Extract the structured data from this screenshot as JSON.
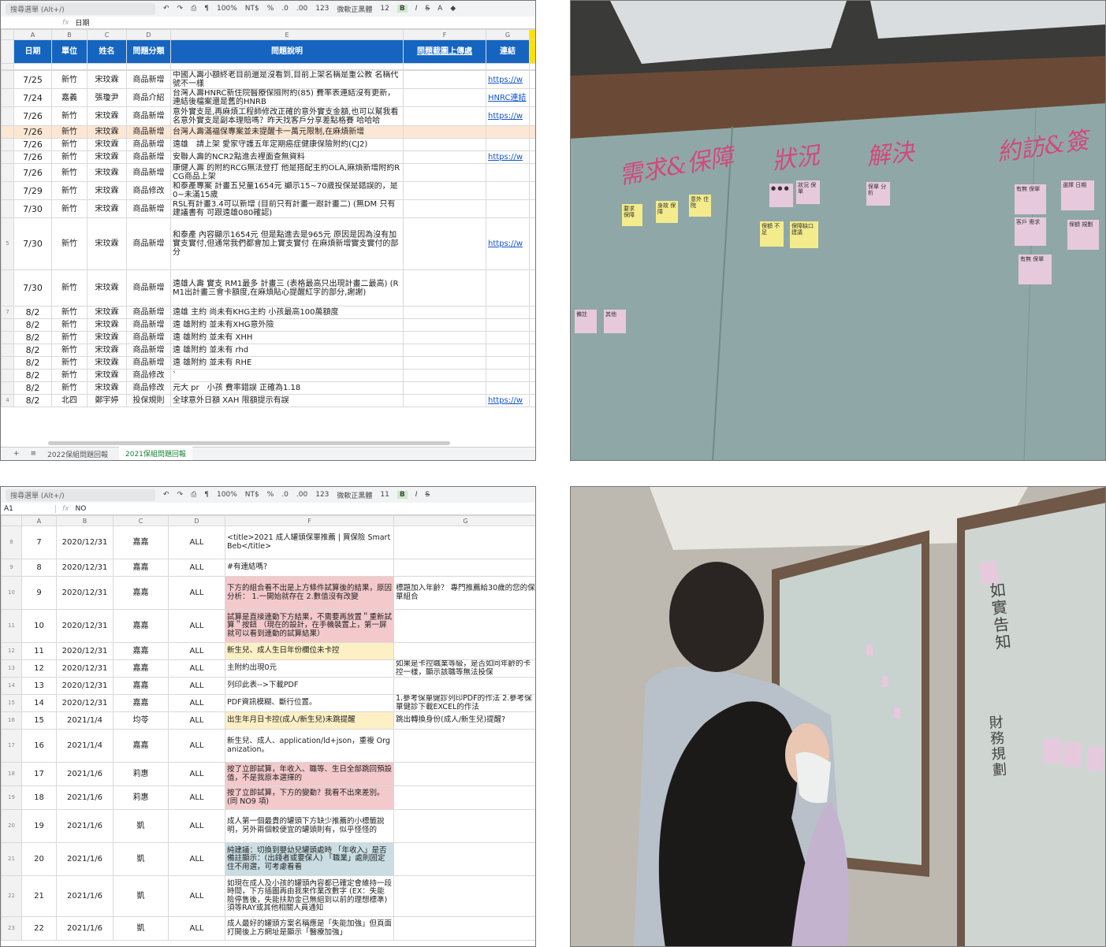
{
  "sheet1": {
    "toolbar": {
      "menu_search": "搜尋選單 (Alt+/)",
      "zoom": "100%",
      "currency": "NT$",
      "percent": "%",
      "dec0": ".0",
      "dec00": ".00",
      "format": "123",
      "font": "微軟正黑體",
      "size": "12",
      "bold": "B",
      "italic": "I",
      "strike": "S",
      "textcolor": "A"
    },
    "formula": {
      "ref": "",
      "fx": "fx",
      "value": "日期"
    },
    "columns": [
      "A",
      "B",
      "C",
      "D",
      "E",
      "F",
      "G"
    ],
    "headers": [
      "日期",
      "單位",
      "姓名",
      "問題分類",
      "問題說明",
      "問題截圖上傳處",
      "連結"
    ],
    "rows": [
      {
        "rn": "",
        "date": "7/25",
        "unit": "新竹",
        "name": "宋玟霖",
        "cat": "商品新增",
        "desc": "中國人壽小額終老目前還是沒看到,目前上架名稱是重公教 名稱代號不一樣",
        "link": "https://w"
      },
      {
        "rn": "",
        "date": "7/24",
        "unit": "嘉義",
        "name": "張瓊尹",
        "cat": "商品介紹",
        "desc": "台灣人壽HNRC新住院醫療保險附約(85) 費率表連結沒有更新，連結後檔案還是舊的HNRB",
        "link": "HNRC連結"
      },
      {
        "rn": "",
        "date": "7/26",
        "unit": "新竹",
        "name": "宋玟霖",
        "cat": "商品新增",
        "desc": "意外實支是,再麻煩工程師修改正確的意外實支金額,也可以幫我看名意外實支是副本理賠嗎？昨天找客戶分享差點格賽 哈哈哈",
        "link": "https://w"
      },
      {
        "rn": "",
        "date": "7/26",
        "unit": "新竹",
        "name": "宋玟霖",
        "cat": "商品新增",
        "desc": "台灣人壽滿福保專案並未提醒卡一萬元限制,在麻煩新增",
        "link": "",
        "hl": true
      },
      {
        "rn": "",
        "date": "7/26",
        "unit": "新竹",
        "name": "宋玟霖",
        "cat": "商品新增",
        "desc": "遠雄　請上架 愛家守護五年定期癌症健康保險附約(CJ2)",
        "link": ""
      },
      {
        "rn": "",
        "date": "7/26",
        "unit": "新竹",
        "name": "宋玟霖",
        "cat": "商品新增",
        "desc": "安聯人壽的NCR2點進去裡面查無資料",
        "link": "https://w"
      },
      {
        "rn": "",
        "date": "7/26",
        "unit": "新竹",
        "name": "宋玟霖",
        "cat": "商品新增",
        "desc": "康健人壽 的附約RCG無法登打 他是搭配主約OLA,麻煩新增附約RCG商品上架",
        "link": ""
      },
      {
        "rn": "",
        "date": "7/29",
        "unit": "新竹",
        "name": "宋玟霖",
        "cat": "商品修改",
        "desc": "和泰產專案 計畫五兒童1654元 顯示15~70歲投保是錯誤的，是0~未滿15歲",
        "link": ""
      },
      {
        "rn": "",
        "date": "7/30",
        "unit": "新竹",
        "name": "宋玟霖",
        "cat": "商品新增",
        "desc": "RSL有計畫3.4可以新增 (目前只有計畫一跟計畫二) (無DM 只有建議書有 可跟遠雄080確認)",
        "link": ""
      },
      {
        "rn": "5",
        "date": "7/30",
        "unit": "新竹",
        "name": "宋玟霖",
        "cat": "商品新增",
        "desc": "和泰產 內容顯示1654元 但是點進去是965元 原因是因為沒有加實支實付,但通常我們都會加上實支實付 在麻煩新增實支實付的部分",
        "link": "https://w",
        "tall": true
      },
      {
        "rn": "",
        "date": "7/30",
        "unit": "新竹",
        "name": "宋玟霖",
        "cat": "商品新增",
        "desc": "遠雄人壽 實支 RM1最多 計畫三 (表格最高只出現計畫二最高) (RM1出計畫三會卡額度,在麻煩貼心提醒紅字的部分,謝謝)",
        "link": "",
        "tall2": true
      },
      {
        "rn": "7",
        "date": "8/2",
        "unit": "新竹",
        "name": "宋玟霖",
        "cat": "商品新增",
        "desc": "遠雄 主約 尚未有KHG主約 小孩最高100萬額度",
        "link": ""
      },
      {
        "rn": "",
        "date": "8/2",
        "unit": "新竹",
        "name": "宋玟霖",
        "cat": "商品新增",
        "desc": "遠 雄附約 並未有XHG意外險",
        "link": ""
      },
      {
        "rn": "",
        "date": "8/2",
        "unit": "新竹",
        "name": "宋玟霖",
        "cat": "商品新增",
        "desc": "遠 雄附約 並未有 XHH",
        "link": ""
      },
      {
        "rn": "",
        "date": "8/2",
        "unit": "新竹",
        "name": "宋玟霖",
        "cat": "商品新增",
        "desc": "遠 雄附約 並未有 rhd",
        "link": ""
      },
      {
        "rn": "",
        "date": "8/2",
        "unit": "新竹",
        "name": "宋玟霖",
        "cat": "商品新增",
        "desc": "遠 雄附約 並未有 RHE",
        "link": ""
      },
      {
        "rn": "",
        "date": "8/2",
        "unit": "新竹",
        "name": "宋玟霖",
        "cat": "商品修改",
        "desc": "`",
        "link": ""
      },
      {
        "rn": "",
        "date": "8/2",
        "unit": "新竹",
        "name": "宋玟霖",
        "cat": "商品修改",
        "desc": "元大 pr　小孩 費率錯誤 正確為1.18",
        "link": ""
      },
      {
        "rn": "4",
        "date": "8/2",
        "unit": "北四",
        "name": "鄭宇婷",
        "cat": "投保規則",
        "desc": "全球意外日額 XAH 限額提示有誤",
        "link": "https://w"
      }
    ],
    "tabs": {
      "add": "+",
      "list": "≡",
      "tab1": "2022保組問題回報",
      "tab2": "2021保組問題回報"
    }
  },
  "sheet2": {
    "toolbar": {
      "menu_search": "搜尋選單 (Alt+/)",
      "zoom": "100%",
      "currency": "NT$",
      "percent": "%",
      "dec0": ".0",
      "dec00": ".00",
      "format": "123",
      "font": "微軟正黑體",
      "size": "11",
      "bold": "B",
      "italic": "I",
      "strike": "S"
    },
    "formula": {
      "ref": "A1",
      "fx": "fx",
      "value": "NO"
    },
    "columns": [
      "A",
      "B",
      "C",
      "D",
      "F",
      "G"
    ],
    "rows": [
      {
        "rn": "8",
        "no": "7",
        "date": "2020/12/31",
        "who": "嘉嘉",
        "scope": "ALL",
        "issue": "<title>2021 成人罐頭保單推薦 | 買保險 SmartBeb</title>",
        "note": "",
        "color": ""
      },
      {
        "rn": "9",
        "no": "8",
        "date": "2020/12/31",
        "who": "嘉嘉",
        "scope": "ALL",
        "issue": "#有連結嗎?",
        "note": "",
        "color": ""
      },
      {
        "rn": "10",
        "no": "9",
        "date": "2020/12/31",
        "who": "嘉嘉",
        "scope": "ALL",
        "issue": "下方的組合看不出是上方條件試算後的結果，原因分析： 1.一開始就存在 2.數值沒有改變",
        "note": "標題加入年齡？ 專門推薦給30歲的您的保單組合",
        "color": "pink"
      },
      {
        "rn": "11",
        "no": "10",
        "date": "2020/12/31",
        "who": "嘉嘉",
        "scope": "ALL",
        "issue": "試算是直接連動下方結果，不需要再放置＂重新試算＂按鈕 （現在的設計，在手機裝置上，第一屏就可以看到連動的試算結果）",
        "note": "",
        "color": "pink"
      },
      {
        "rn": "12",
        "no": "11",
        "date": "2020/12/31",
        "who": "嘉嘉",
        "scope": "ALL",
        "issue": "新生兒、成人生日年份欄位未卡控",
        "note": "",
        "color": "yel"
      },
      {
        "rn": "13",
        "no": "12",
        "date": "2020/12/31",
        "who": "嘉嘉",
        "scope": "ALL",
        "issue": "主附約出現0元",
        "note": "如果是卡控職業等級，是否如同年齡的卡控一樣，顯示該職等無法投保",
        "color": ""
      },
      {
        "rn": "14",
        "no": "13",
        "date": "2020/12/31",
        "who": "嘉嘉",
        "scope": "ALL",
        "issue": "列印此表-->下載PDF",
        "note": "",
        "color": ""
      },
      {
        "rn": "15",
        "no": "14",
        "date": "2020/12/31",
        "who": "嘉嘉",
        "scope": "ALL",
        "issue": "PDF資訊模糊、斷行位置。",
        "note": "1.參考保單健診列印PDF的作法 2.參考保單健診下載EXCEL的作法",
        "color": ""
      },
      {
        "rn": "16",
        "no": "15",
        "date": "2021/1/4",
        "who": "均苓",
        "scope": "ALL",
        "issue": "出生年月日卡控(成人/新生兒)未跳提醒",
        "note": "跳出轉換身份(成人/新生兒)提醒?",
        "color": "yel"
      },
      {
        "rn": "17",
        "no": "16",
        "date": "2021/1/4",
        "who": "嘉嘉",
        "scope": "ALL",
        "issue": "新生兒、成人、application/ld+json，重複 Organization。",
        "note": "",
        "color": ""
      },
      {
        "rn": "18",
        "no": "17",
        "date": "2021/1/6",
        "who": "莉惠",
        "scope": "ALL",
        "issue": "按了立即試算，年收入、職等、生日全部跳回預設值，不是我原本選擇的",
        "note": "",
        "color": "pink"
      },
      {
        "rn": "19",
        "no": "18",
        "date": "2021/1/6",
        "who": "莉惠",
        "scope": "ALL",
        "issue": "按了立即試算，下方的變動？我看不出來差別。(同 NO9 項)",
        "note": "",
        "color": "pink"
      },
      {
        "rn": "20",
        "no": "19",
        "date": "2021/1/6",
        "who": "凱",
        "scope": "ALL",
        "issue": "成人第一個最貴的罐頭下方缺少推薦的小標籤說明，另外兩個較便宜的罐頭則有，似乎怪怪的",
        "note": "",
        "color": ""
      },
      {
        "rn": "21",
        "no": "20",
        "date": "2021/1/6",
        "who": "凱",
        "scope": "ALL",
        "issue": "純建議：切換到嬰幼兒罐頭處時 「年收入」是否備註顯示：(出錢者或要保人) 「職業」處則固定住不用選，可考慮看看",
        "note": "",
        "color": "blu"
      },
      {
        "rn": "22",
        "no": "21",
        "date": "2021/1/6",
        "who": "凱",
        "scope": "ALL",
        "issue": "如現在成人及小孩的罐頭內容都已確定會維持一段時間，下方插圖再由我來作業改數字 (EX：失能險停售後，失能扶助金已無組到以前的理想標準) 須等RAY或其他相關人員通知",
        "note": "",
        "color": ""
      },
      {
        "rn": "23",
        "no": "22",
        "date": "2021/1/6",
        "who": "凱",
        "scope": "ALL",
        "issue": "成人最好的罐頭方案名稱應是「失能加強」但頁面打開後上方網址是顯示「醫療加強」",
        "note": "",
        "color": ""
      }
    ]
  },
  "photo1": {
    "headings": [
      "需求&保障",
      "狀況",
      "解決",
      "約訪&簽"
    ],
    "notes": [
      {
        "text": "要求 保障",
        "color": "yel"
      },
      {
        "text": "身故 保障",
        "color": "yel"
      },
      {
        "text": "意外 住院",
        "color": "yel"
      },
      {
        "text": "● ● ●",
        "color": "pink"
      },
      {
        "text": "狀況 保單",
        "color": "pink"
      },
      {
        "text": "保單 分析",
        "color": "pink"
      },
      {
        "text": "保額 不足",
        "color": "yel"
      },
      {
        "text": "保障缺口 建議",
        "color": "yel"
      },
      {
        "text": "有無 保單",
        "color": "pink"
      },
      {
        "text": "選擇 日期",
        "color": "pink"
      },
      {
        "text": "客戶 需求",
        "color": "pink"
      },
      {
        "text": "保額 規劃",
        "color": "pink"
      },
      {
        "text": "有無 保單",
        "color": "pink"
      },
      {
        "text": "備註",
        "color": "pink"
      },
      {
        "text": "其他",
        "color": "pink"
      }
    ]
  },
  "photo2": {
    "whiteboard_words": [
      "如實告知",
      "財務規劃"
    ]
  }
}
